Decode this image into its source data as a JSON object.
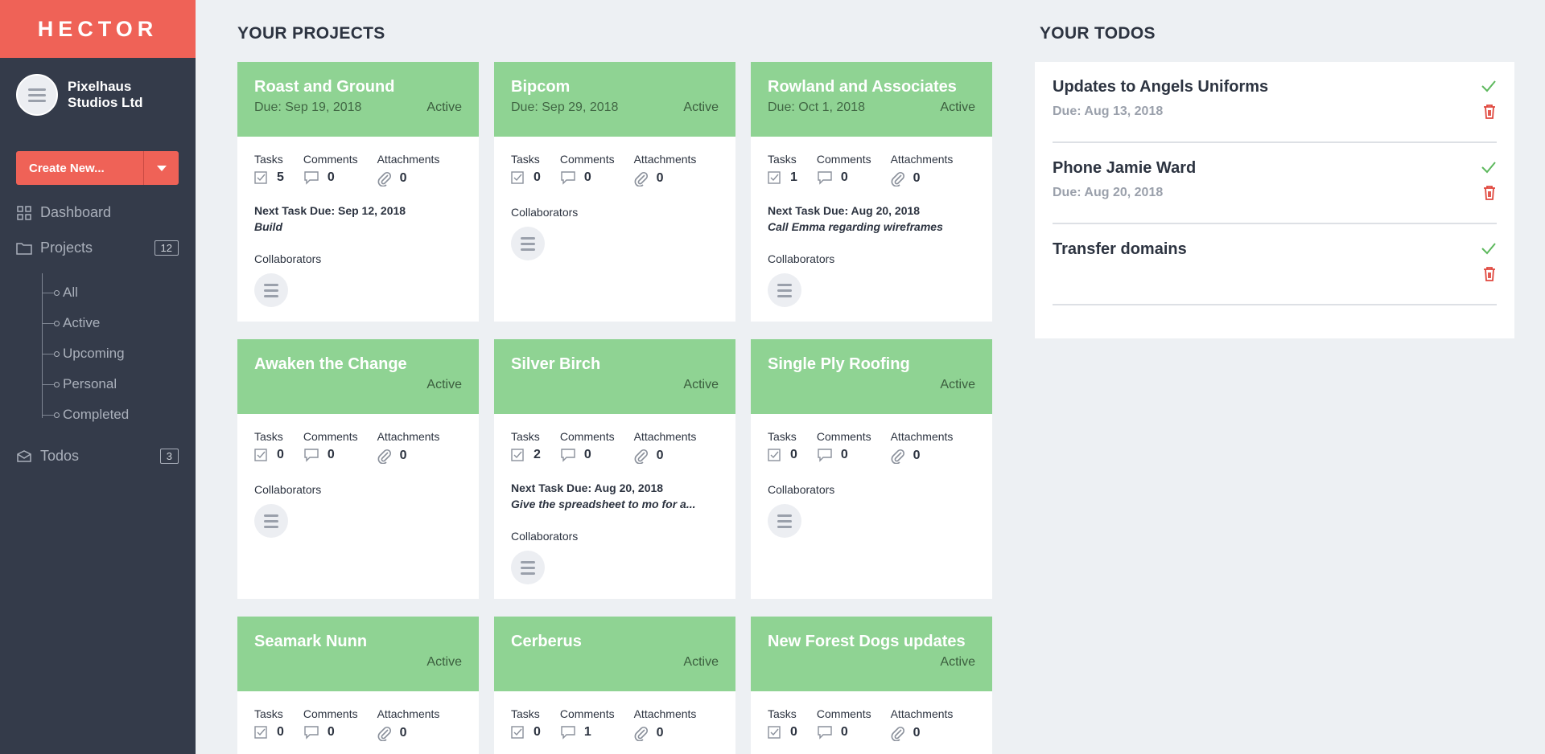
{
  "app": {
    "logo": "HECTOR"
  },
  "sidebar": {
    "org_name_line1": "Pixelhaus",
    "org_name_line2": "Studios Ltd",
    "create_label": "Create New...",
    "nav": {
      "dashboard": "Dashboard",
      "projects": "Projects",
      "projects_count": "12",
      "todos": "Todos",
      "todos_count": "3"
    },
    "project_filters": [
      "All",
      "Active",
      "Upcoming",
      "Personal",
      "Completed"
    ]
  },
  "projects_title": "YOUR PROJECTS",
  "todos_title": "YOUR TODOS",
  "labels": {
    "tasks": "Tasks",
    "comments": "Comments",
    "attachments": "Attachments",
    "collaborators": "Collaborators"
  },
  "projects": [
    {
      "title": "Roast and Ground",
      "due": "Due: Sep 19, 2018",
      "status": "Active",
      "tasks": "5",
      "comments": "0",
      "attachments": "0",
      "next_task": "Next Task Due: Sep 12, 2018",
      "next_task_name": "Build"
    },
    {
      "title": "Bipcom",
      "due": "Due: Sep 29, 2018",
      "status": "Active",
      "tasks": "0",
      "comments": "0",
      "attachments": "0",
      "next_task": "",
      "next_task_name": ""
    },
    {
      "title": "Rowland and Associates",
      "due": "Due: Oct 1, 2018",
      "status": "Active",
      "tasks": "1",
      "comments": "0",
      "attachments": "0",
      "next_task": "Next Task Due: Aug 20, 2018",
      "next_task_name": "Call Emma regarding wireframes"
    },
    {
      "title": "Awaken the Change",
      "due": "",
      "status": "Active",
      "tasks": "0",
      "comments": "0",
      "attachments": "0",
      "next_task": "",
      "next_task_name": ""
    },
    {
      "title": "Silver Birch",
      "due": "",
      "status": "Active",
      "tasks": "2",
      "comments": "0",
      "attachments": "0",
      "next_task": "Next Task Due: Aug 20, 2018",
      "next_task_name": "Give the spreadsheet to mo for a..."
    },
    {
      "title": "Single Ply Roofing",
      "due": "",
      "status": "Active",
      "tasks": "0",
      "comments": "0",
      "attachments": "0",
      "next_task": "",
      "next_task_name": ""
    },
    {
      "title": "Seamark Nunn",
      "due": "",
      "status": "Active",
      "tasks": "0",
      "comments": "0",
      "attachments": "0",
      "next_task": "",
      "next_task_name": ""
    },
    {
      "title": "Cerberus",
      "due": "",
      "status": "Active",
      "tasks": "0",
      "comments": "1",
      "attachments": "0",
      "next_task": "",
      "next_task_name": ""
    },
    {
      "title": "New Forest Dogs updates",
      "due": "",
      "status": "Active",
      "tasks": "0",
      "comments": "0",
      "attachments": "0",
      "next_task": "",
      "next_task_name": ""
    }
  ],
  "todos": [
    {
      "title": "Updates to Angels Uniforms",
      "due": "Due: Aug 13, 2018"
    },
    {
      "title": "Phone Jamie Ward",
      "due": "Due: Aug 20, 2018"
    },
    {
      "title": "Transfer domains",
      "due": ""
    }
  ],
  "colors": {
    "brand": "#ef6257",
    "sidebar": "#343b4a",
    "card_header": "#8fd393",
    "check": "#5cb85c",
    "trash": "#e0483e"
  },
  "icons": {
    "tasks": "checkbox-icon",
    "comments": "speech-bubble-icon",
    "attachments": "paperclip-icon",
    "dashboard": "grid-icon",
    "projects": "folder-icon",
    "todos": "inbox-icon",
    "todo_done": "check-icon",
    "todo_delete": "trash-icon"
  }
}
